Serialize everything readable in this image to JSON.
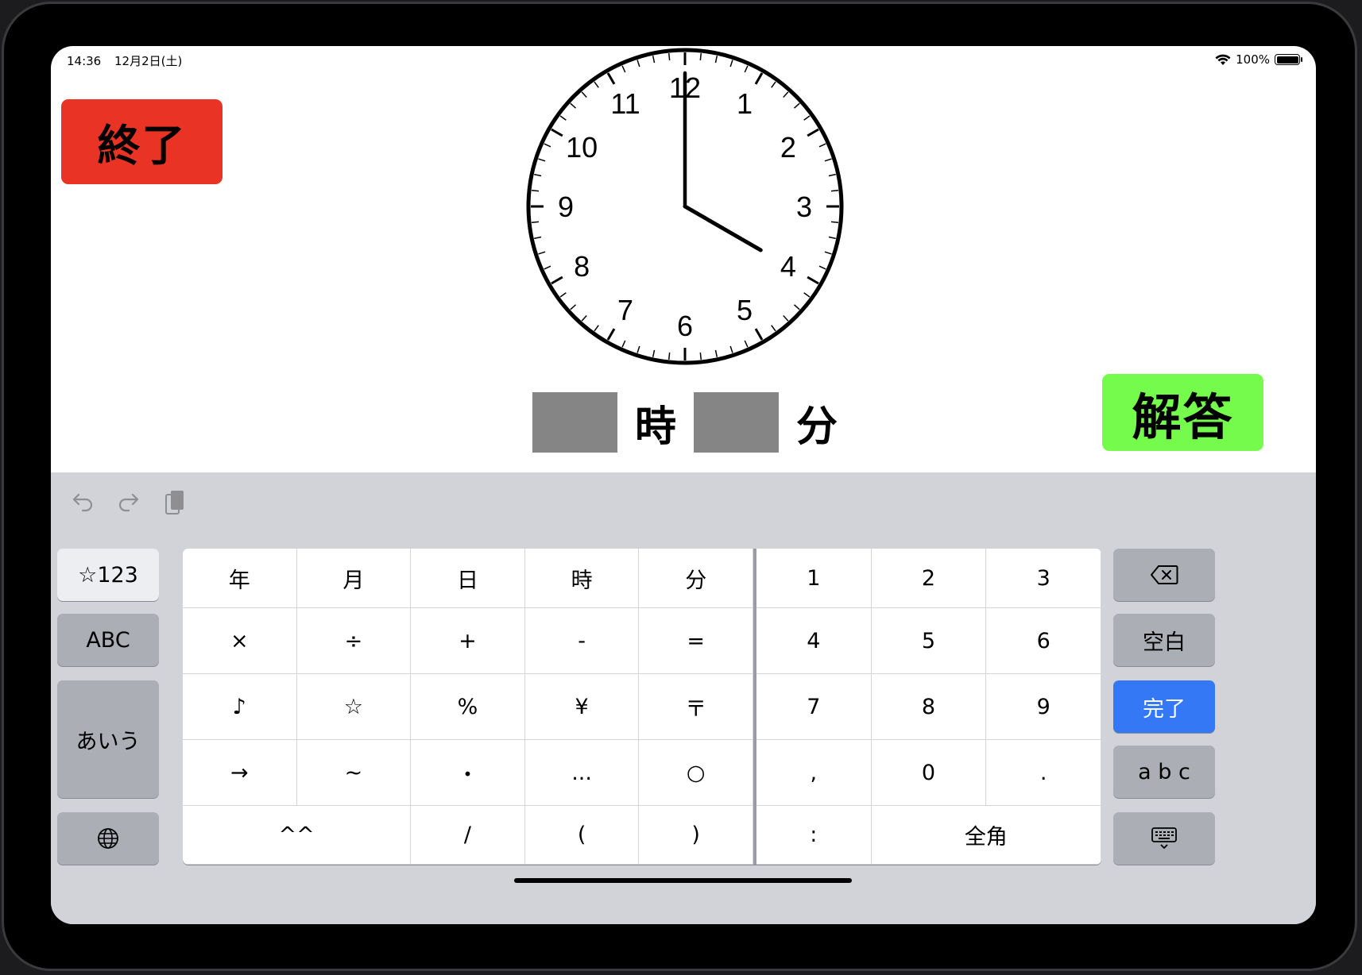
{
  "status": {
    "time": "14:36",
    "date": "12月2日(土)",
    "battery": "100%"
  },
  "buttons": {
    "end": "終了",
    "answer": "解答"
  },
  "clock": {
    "numbers": [
      "12",
      "1",
      "2",
      "3",
      "4",
      "5",
      "6",
      "7",
      "8",
      "9",
      "10",
      "11"
    ],
    "hour_hand_at": 4,
    "minute_hand_at": 0
  },
  "answer": {
    "hour_unit": "時",
    "minute_unit": "分"
  },
  "keyboard": {
    "left_keys": [
      "☆123",
      "ABC",
      "あいう"
    ],
    "symbol_rows": [
      [
        "年",
        "月",
        "日",
        "時",
        "分"
      ],
      [
        "×",
        "÷",
        "+",
        "-",
        "="
      ],
      [
        "♪",
        "☆",
        "%",
        "¥",
        "〒"
      ],
      [
        "→",
        "~",
        "・",
        "...",
        "○"
      ],
      [
        "^^",
        "/",
        "(",
        ")"
      ]
    ],
    "number_rows": [
      [
        "1",
        "2",
        "3"
      ],
      [
        "4",
        "5",
        "6"
      ],
      [
        "7",
        "8",
        "9"
      ],
      [
        ",",
        "0",
        "."
      ],
      [
        ":",
        "全角"
      ]
    ],
    "right_keys": {
      "space": "空白",
      "done": "完了",
      "abc": "a b c"
    },
    "colors": {
      "done": "#3478f6",
      "end_button": "#e93325",
      "answer_button": "#75fb4c"
    }
  }
}
